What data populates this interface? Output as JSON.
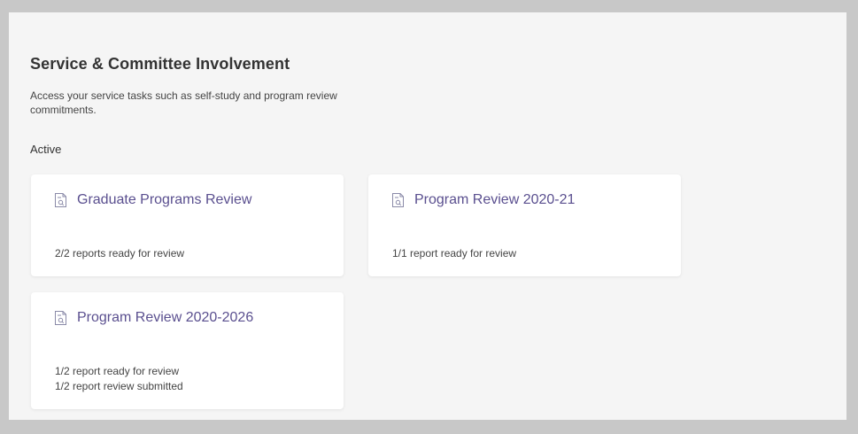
{
  "page": {
    "title": "Service & Committee Involvement",
    "description": "Access your service tasks such as self-study and program review commitments.",
    "section_label": "Active"
  },
  "cards": [
    {
      "title": "Graduate Programs Review",
      "icon": "document-icon",
      "status_lines": [
        "2/2 reports ready for review"
      ]
    },
    {
      "title": "Program Review 2020-21",
      "icon": "document-icon",
      "status_lines": [
        "1/1 report ready for review"
      ]
    },
    {
      "title": "Program Review 2020-2026",
      "icon": "document-icon",
      "status_lines": [
        "1/2 report ready for review",
        "1/2 report review submitted"
      ]
    }
  ],
  "colors": {
    "accent": "#5a4f8f",
    "card_bg": "#ffffff",
    "panel_bg": "#f5f5f5",
    "frame_bg": "#c8c8c8"
  }
}
